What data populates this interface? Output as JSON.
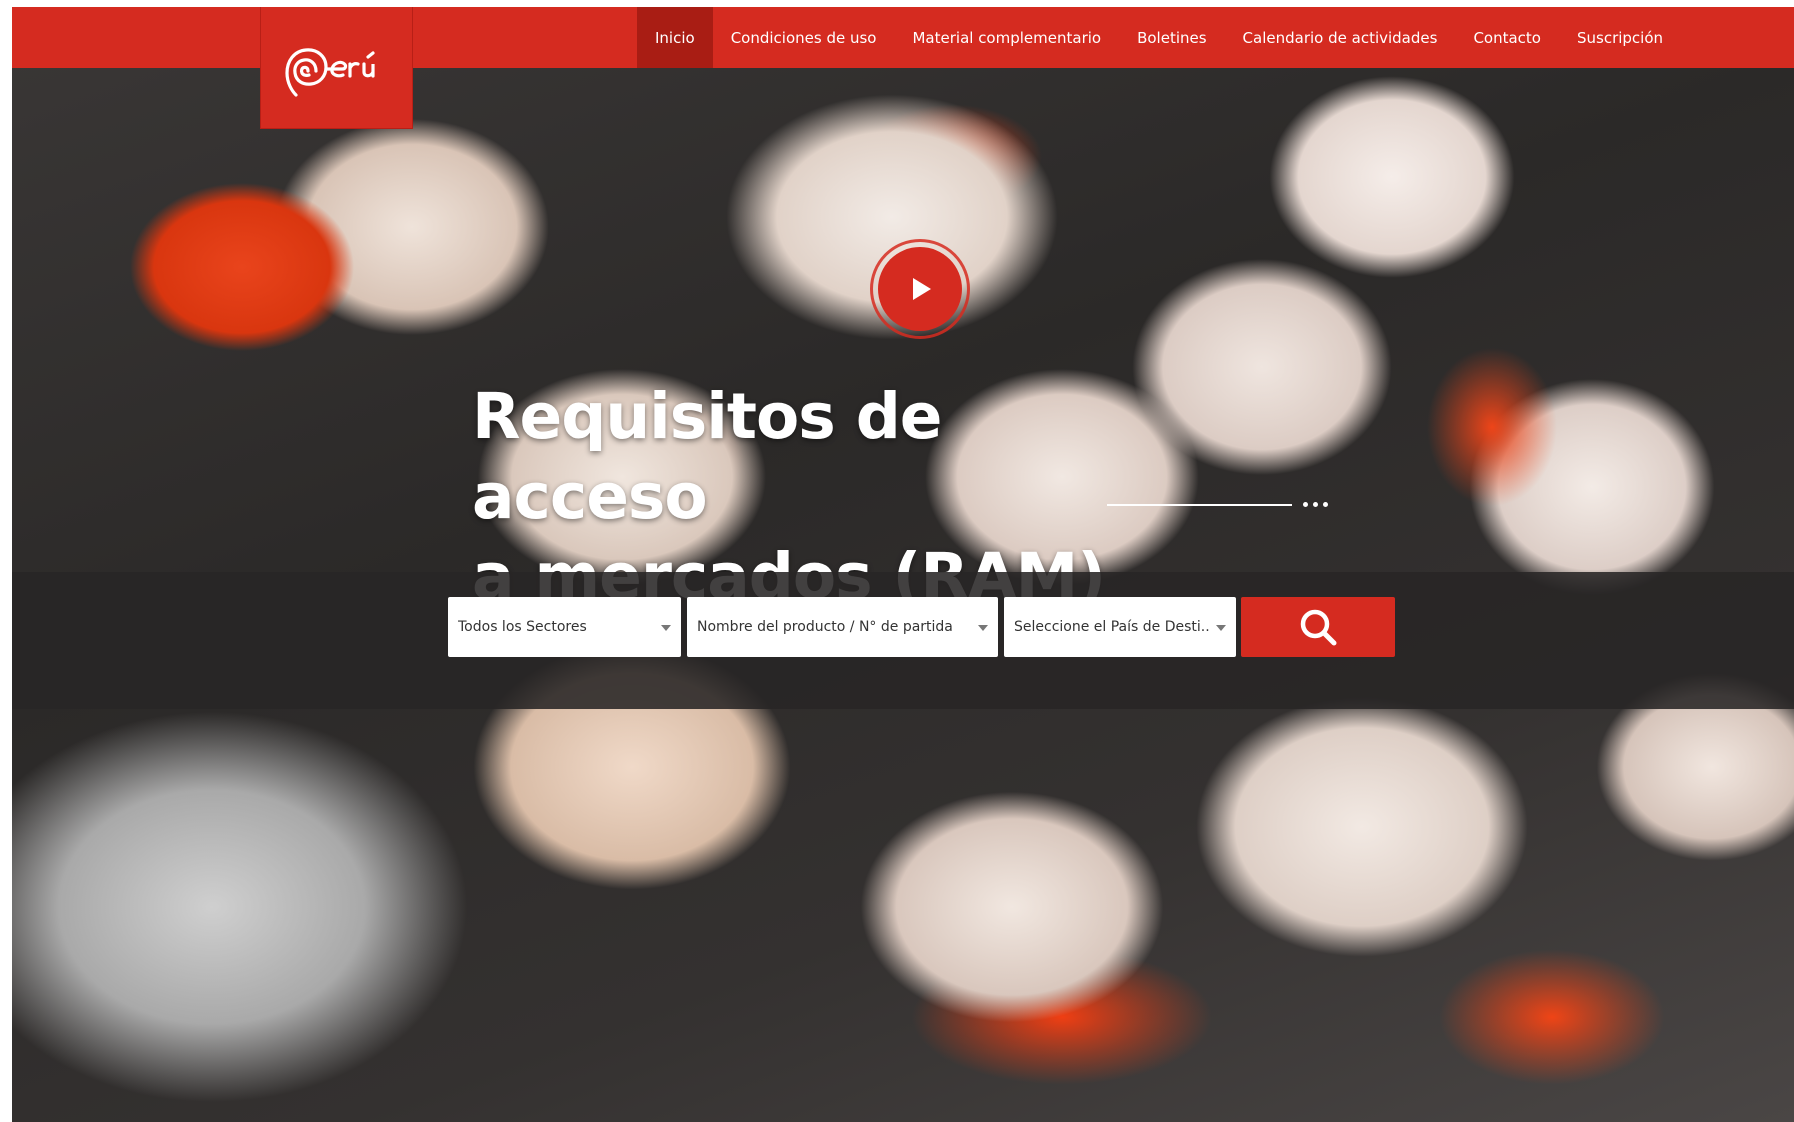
{
  "brand": {
    "logo_text": "Perú",
    "accent_color": "#d52b20"
  },
  "nav": {
    "items": [
      {
        "label": "Inicio",
        "active": true
      },
      {
        "label": "Condiciones de uso",
        "active": false
      },
      {
        "label": "Material complementario",
        "active": false
      },
      {
        "label": "Boletines",
        "active": false
      },
      {
        "label": "Calendario de actividades",
        "active": false
      },
      {
        "label": "Contacto",
        "active": false
      },
      {
        "label": "Suscripción",
        "active": false
      }
    ]
  },
  "hero": {
    "title_line1": "Requisitos de acceso",
    "title_line2": "a mercados (RAM)",
    "play_icon": "play-icon"
  },
  "search": {
    "sector_select": "Todos los Sectores",
    "product_select": "Nombre del producto / N° de partida",
    "country_select": "Seleccione el País de Desti...",
    "button_icon": "search-icon"
  }
}
